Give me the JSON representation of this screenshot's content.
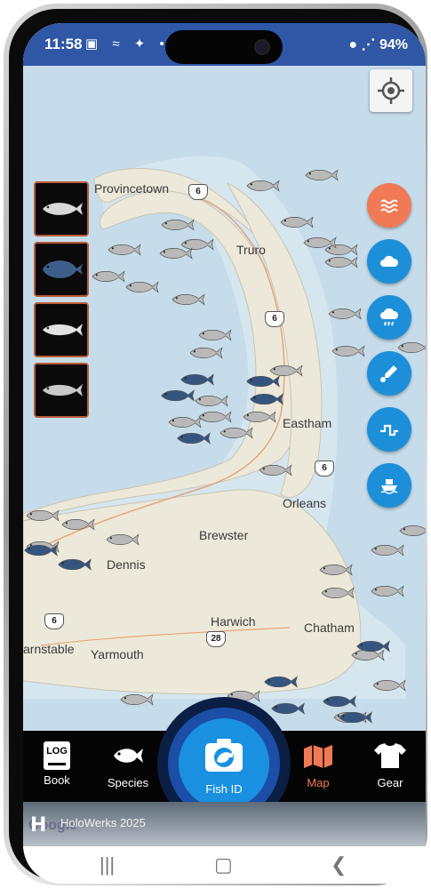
{
  "status": {
    "time": "11:58",
    "left_icons": "▣ ≈ ✦ •",
    "right_text": "● ⋰ 94%"
  },
  "map": {
    "places": [
      "Provincetown",
      "Truro",
      "Eastham",
      "Orleans",
      "Brewster",
      "Dennis",
      "Harwich",
      "Chatham",
      "arnstable",
      "Yarmouth"
    ],
    "routes": [
      "6",
      "6",
      "6",
      "6",
      "28"
    ]
  },
  "side_buttons": [
    {
      "name": "tide-button",
      "icon": "waves-icon",
      "active": true
    },
    {
      "name": "weather-button",
      "icon": "cloud-icon",
      "active": false
    },
    {
      "name": "rain-button",
      "icon": "rain-cloud-icon",
      "active": false
    },
    {
      "name": "temperature-button",
      "icon": "thermometer-icon",
      "active": false
    },
    {
      "name": "pressure-button",
      "icon": "wave-pulse-icon",
      "active": false
    },
    {
      "name": "boat-button",
      "icon": "boat-icon",
      "active": false
    }
  ],
  "nav": {
    "log_icon_text": "LOG",
    "log": "Book",
    "species": "Species",
    "fish_id": "Fish ID",
    "map": "Map",
    "gear": "Gear"
  },
  "colors": {
    "accent": "#f07a55",
    "button_blue": "#1d8fd9",
    "status_bar": "#2f57a6"
  },
  "footer": {
    "copyright": "HoloWerks 2025",
    "google": "Google"
  }
}
